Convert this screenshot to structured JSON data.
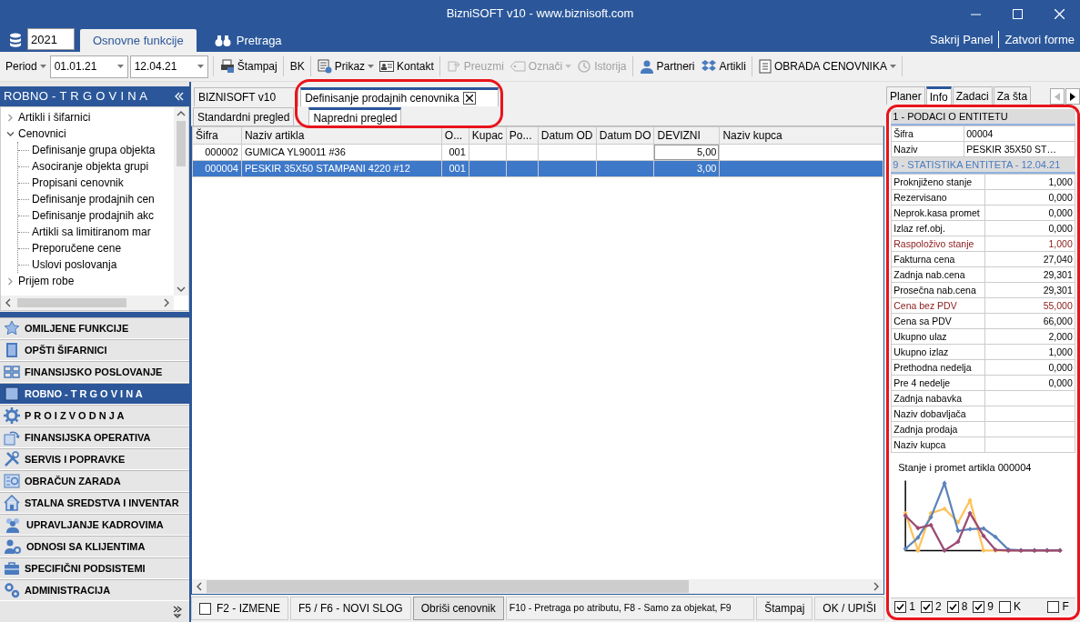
{
  "window": {
    "title": "BizniSOFT v10 - www.biznisoft.com"
  },
  "ribbon": {
    "year": "2021",
    "tabs": [
      {
        "label": "Osnovne funkcije",
        "selected": true
      },
      {
        "label": "Pretraga",
        "selected": false
      }
    ],
    "links": [
      "Sakrij Panel",
      "Zatvori forme"
    ]
  },
  "toolbar": {
    "period_label": "Period",
    "date_from": "01.01.21",
    "date_to": "12.04.21",
    "items": [
      {
        "label": "Štampaj",
        "disabled": false,
        "dropdown": false,
        "separator_after": true
      },
      {
        "label": "BK",
        "disabled": false,
        "dropdown": false,
        "separator_after": true
      },
      {
        "label": "Prikaz",
        "disabled": false,
        "dropdown": true,
        "separator_after": false
      },
      {
        "label": "Kontakt",
        "disabled": false,
        "dropdown": false,
        "separator_after": true
      },
      {
        "label": "Preuzmi",
        "disabled": true,
        "dropdown": false,
        "separator_after": false
      },
      {
        "label": "Označi",
        "disabled": true,
        "dropdown": true,
        "separator_after": false
      },
      {
        "label": "Istorija",
        "disabled": true,
        "dropdown": false,
        "separator_after": true
      },
      {
        "label": "Partneri",
        "disabled": false,
        "dropdown": false,
        "separator_after": false
      },
      {
        "label": "Artikli",
        "disabled": false,
        "dropdown": false,
        "separator_after": true
      },
      {
        "label": "OBRADA CENOVNIKA",
        "disabled": false,
        "dropdown": true,
        "separator_after": true
      }
    ]
  },
  "sidebar": {
    "title": "ROBNO - T R G O V I N A",
    "tree": [
      {
        "label": "Artikli i šifarnici",
        "expanded": false
      },
      {
        "label": "Cenovnici",
        "expanded": true,
        "children": [
          {
            "label": "Definisanje grupa objekta"
          },
          {
            "label": "Asociranje objekta grupi"
          },
          {
            "label": "Propisani cenovnik"
          },
          {
            "label": "Definisanje prodajnih cen"
          },
          {
            "label": "Definisanje prodajnih akc"
          },
          {
            "label": "Artikli sa limitiranom mar"
          },
          {
            "label": "Preporučene cene"
          },
          {
            "label": "Uslovi poslovanja"
          }
        ]
      },
      {
        "label": "Prijem robe",
        "expanded": false
      }
    ],
    "modules": [
      {
        "label": "OMILJENE FUNKCIJE",
        "selected": false
      },
      {
        "label": "OPŠTI ŠIFARNICI",
        "selected": false
      },
      {
        "label": "FINANSIJSKO POSLOVANJE",
        "selected": false
      },
      {
        "label": "ROBNO - T R G O V I N A",
        "selected": true
      },
      {
        "label": "P R O I Z V O D N J A",
        "selected": false
      },
      {
        "label": "FINANSIJSKA OPERATIVA",
        "selected": false
      },
      {
        "label": "SERVIS I POPRAVKE",
        "selected": false
      },
      {
        "label": "OBRAČUN ZARADA",
        "selected": false
      },
      {
        "label": "STALNA SREDSTVA I INVENTAR",
        "selected": false
      },
      {
        "label": "UPRAVLJANJE KADROVIMA",
        "selected": false
      },
      {
        "label": "ODNOSI SA KLIJENTIMA",
        "selected": false
      },
      {
        "label": "SPECIFIČNI PODSISTEMI",
        "selected": false
      },
      {
        "label": "ADMINISTRACIJA",
        "selected": false
      }
    ]
  },
  "document_tabs": {
    "highlighted": true,
    "tabs": [
      {
        "label": "BIZNISOFT v10",
        "selected": false,
        "closable": false
      },
      {
        "label": "Definisanje prodajnih cenovnika",
        "selected": true,
        "closable": true
      }
    ],
    "view_tabs": [
      {
        "label": "Standardni pregled",
        "selected": false
      },
      {
        "label": "Napredni pregled",
        "selected": true
      }
    ]
  },
  "grid": {
    "columns": [
      "Šifra",
      "Naziv artikla",
      "O...",
      "Kupac",
      "Po...",
      "Datum OD",
      "Datum DO",
      "DEVIZNI",
      "Naziv kupca"
    ],
    "rows": [
      {
        "selected": false,
        "cells": [
          "000002",
          "GUMICA YL90011 #36",
          "001",
          "",
          "",
          "",
          "",
          "5,00",
          ""
        ]
      },
      {
        "selected": true,
        "cells": [
          "000004",
          "PESKIR 35X50 STAMPANI 4220 #12",
          "001",
          "",
          "",
          "",
          "",
          "3,00",
          ""
        ]
      }
    ]
  },
  "bottom_bar": [
    {
      "kind": "checkbox",
      "label": "F2 - IZMENE",
      "checked": false
    },
    {
      "kind": "button",
      "label": "F5 / F6 - NOVI SLOG"
    },
    {
      "kind": "button",
      "label": "Obriši cenovnik"
    },
    {
      "kind": "hint",
      "label": "F10 - Pretraga po atributu, F8 - Samo za objekat, F9"
    },
    {
      "kind": "button",
      "label": "Štampaj"
    },
    {
      "kind": "button",
      "label": "OK / UPIŠI"
    }
  ],
  "info_panel": {
    "highlighted": true,
    "tabs": [
      {
        "label": "Planer",
        "selected": false
      },
      {
        "label": "Info",
        "selected": true
      },
      {
        "label": "Zadaci",
        "selected": false
      },
      {
        "label": "Za šta",
        "selected": false
      }
    ],
    "sections": [
      {
        "title": "1 - PODACI O ENTITETU",
        "kind": "details",
        "active": false,
        "rows": [
          {
            "label": "Šifra",
            "value": "00004",
            "emphasized": false
          },
          {
            "label": "Naziv",
            "value": "PESKIR 35X50 ST…",
            "emphasized": false
          }
        ]
      },
      {
        "title": "9 - STATISTIKA ENTITETA - 12.04.21",
        "kind": "statistics",
        "active": true,
        "rows": [
          {
            "label": "Proknjiženo stanje",
            "value": "1,000",
            "emphasized": false
          },
          {
            "label": "Rezervisano",
            "value": "0,000",
            "emphasized": false
          },
          {
            "label": "Neprok.kasa promet",
            "value": "0,000",
            "emphasized": false
          },
          {
            "label": "Izlaz ref.obj.",
            "value": "0,000",
            "emphasized": false
          },
          {
            "label": "Raspoloživo stanje",
            "value": "1,000",
            "emphasized": true
          },
          {
            "label": "Fakturna cena",
            "value": "27,040",
            "emphasized": false
          },
          {
            "label": "Zadnja nab.cena",
            "value": "29,301",
            "emphasized": false
          },
          {
            "label": "Prosečna nab.cena",
            "value": "29,301",
            "emphasized": false
          },
          {
            "label": "Cena bez PDV",
            "value": "55,000",
            "emphasized": true
          },
          {
            "label": "Cena sa PDV",
            "value": "66,000",
            "emphasized": false
          },
          {
            "label": "Ukupno ulaz",
            "value": "2,000",
            "emphasized": false
          },
          {
            "label": "Ukupno izlaz",
            "value": "1,000",
            "emphasized": false
          },
          {
            "label": "Prethodna nedelja",
            "value": "0,000",
            "emphasized": false
          },
          {
            "label": "Pre 4 nedelje",
            "value": "0,000",
            "emphasized": false
          },
          {
            "label": "Zadnja nabavka",
            "emphasized": false
          },
          {
            "label": "Naziv dobavljača",
            "emphasized": false
          },
          {
            "label": "Zadnja prodaja",
            "emphasized": false
          },
          {
            "label": "Naziv kupca",
            "emphasized": false
          }
        ]
      }
    ],
    "chart": {
      "title": "Stanje i promet artikla 000004"
    },
    "legend": [
      {
        "label": "1",
        "checked": true
      },
      {
        "label": "2",
        "checked": true
      },
      {
        "label": "8",
        "checked": true
      },
      {
        "label": "9",
        "checked": true
      },
      {
        "label": "K",
        "checked": false
      },
      {
        "label": "F",
        "checked": false
      }
    ]
  }
}
